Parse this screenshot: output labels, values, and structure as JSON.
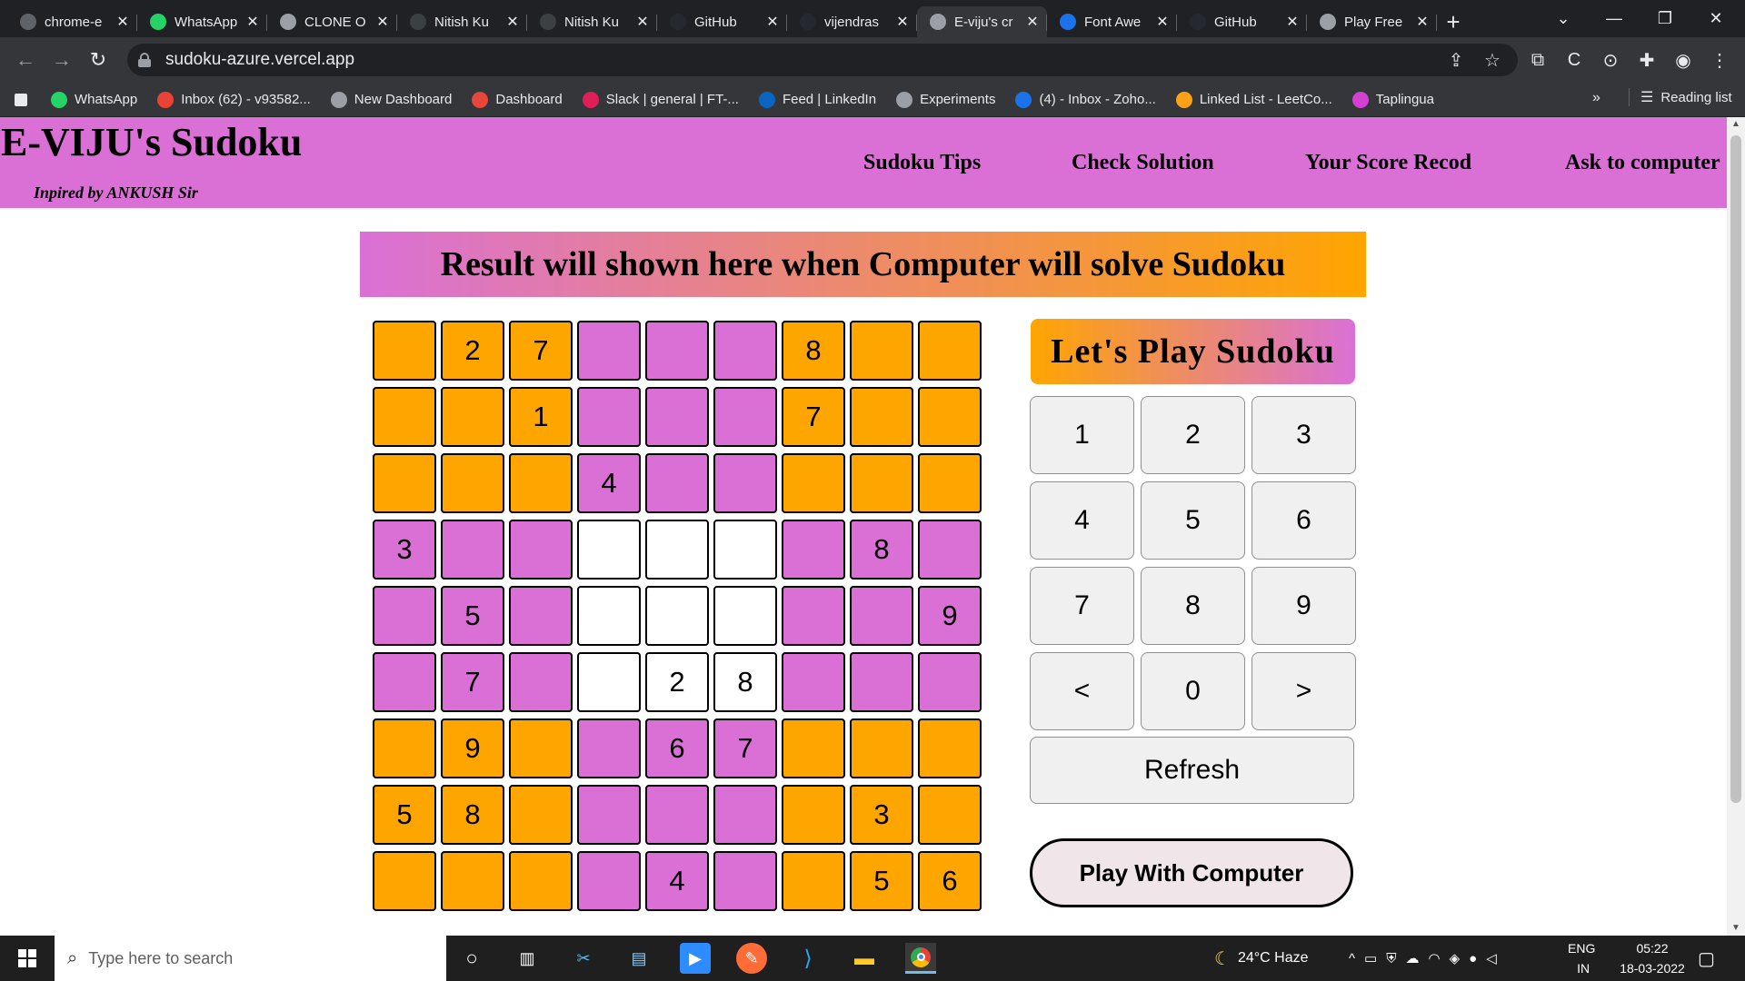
{
  "browser": {
    "tabs": [
      {
        "label": "chrome-e",
        "icon": "tab-page-icon",
        "color": "#5f6368"
      },
      {
        "label": "WhatsApp",
        "icon": "whatsapp-icon",
        "color": "#25d366"
      },
      {
        "label": "CLONE O",
        "icon": "globe-icon",
        "color": "#9aa0a6"
      },
      {
        "label": "Nitish Ku",
        "icon": "notion-icon",
        "color": "#3c4043"
      },
      {
        "label": "Nitish Ku",
        "icon": "notion-icon",
        "color": "#3c4043"
      },
      {
        "label": "GitHub",
        "icon": "github-icon",
        "color": "#24292f"
      },
      {
        "label": "vijendras",
        "icon": "github-icon",
        "color": "#24292f"
      },
      {
        "label": "E-viju's cr",
        "icon": "globe-icon",
        "color": "#9aa0a6"
      },
      {
        "label": "Font Awe",
        "icon": "flag-icon",
        "color": "#1a73e8"
      },
      {
        "label": "GitHub",
        "icon": "github-icon",
        "color": "#24292f"
      },
      {
        "label": "Play Free",
        "icon": "grid-icon",
        "color": "#9aa0a6"
      }
    ],
    "active_tab_index": 7,
    "new_tab_label": "+",
    "url": "sudoku-azure.vercel.app",
    "bookmarks": [
      {
        "label": "WhatsApp",
        "color": "#25d366"
      },
      {
        "label": "Inbox (62) - v93582...",
        "color": "#ea4335"
      },
      {
        "label": "New Dashboard",
        "color": "#9aa0a6"
      },
      {
        "label": "Dashboard",
        "color": "#e8453c"
      },
      {
        "label": "Slack | general | FT-...",
        "color": "#e01e5a"
      },
      {
        "label": "Feed | LinkedIn",
        "color": "#0a66c2"
      },
      {
        "label": "Experiments",
        "color": "#9aa0a6"
      },
      {
        "label": "(4) - Inbox - Zoho...",
        "color": "#1a73e8"
      },
      {
        "label": "Linked List - LeetCo...",
        "color": "#ffa116"
      },
      {
        "label": "Taplingua",
        "color": "#d43fd4"
      }
    ],
    "bookmarks_more": "»",
    "reading_list": "Reading list"
  },
  "site": {
    "title": "E-VIJU's Sudoku",
    "subtitle": "Inpired by ANKUSH Sir",
    "nav": [
      "Sudoku Tips",
      "Check Solution",
      "Your Score Recod",
      "Ask to computer"
    ],
    "result_banner": "Result will shown here when Computer will solve Sudoku"
  },
  "colors": {
    "orange": "#ffa500",
    "pink": "#da70d6",
    "white": "#ffffff"
  },
  "sudoku": {
    "rows": [
      [
        "",
        "2",
        "7",
        "",
        "",
        "",
        "8",
        "",
        ""
      ],
      [
        "",
        "",
        "1",
        "",
        "",
        "",
        "7",
        "",
        ""
      ],
      [
        "",
        "",
        "",
        "4",
        "",
        "",
        "",
        "",
        ""
      ],
      [
        "3",
        "",
        "",
        "",
        "",
        "",
        "",
        "8",
        ""
      ],
      [
        "",
        "5",
        "",
        "",
        "",
        "",
        "",
        "",
        "9"
      ],
      [
        "",
        "7",
        "",
        "",
        "2",
        "8",
        "",
        "",
        ""
      ],
      [
        "",
        "9",
        "",
        "",
        "6",
        "7",
        "",
        "",
        ""
      ],
      [
        "5",
        "8",
        "",
        "",
        "",
        "",
        "",
        "3",
        ""
      ],
      [
        "",
        "",
        "",
        "",
        "4",
        "",
        "",
        "5",
        "6"
      ]
    ],
    "box_colors": [
      [
        "orange",
        "pink",
        "orange"
      ],
      [
        "pink",
        "white",
        "pink"
      ],
      [
        "orange",
        "pink",
        "orange"
      ]
    ]
  },
  "panel": {
    "title": "Let's Play Sudoku",
    "keys": [
      "1",
      "2",
      "3",
      "4",
      "5",
      "6",
      "7",
      "8",
      "9",
      "<",
      "0",
      ">"
    ],
    "refresh": "Refresh",
    "play_computer": "Play With Computer"
  },
  "taskbar": {
    "search_placeholder": "Type here to search",
    "weather": "24°C  Haze",
    "lang_top": "ENG",
    "lang_bottom": "IN",
    "time": "05:22",
    "date": "18-03-2022"
  }
}
